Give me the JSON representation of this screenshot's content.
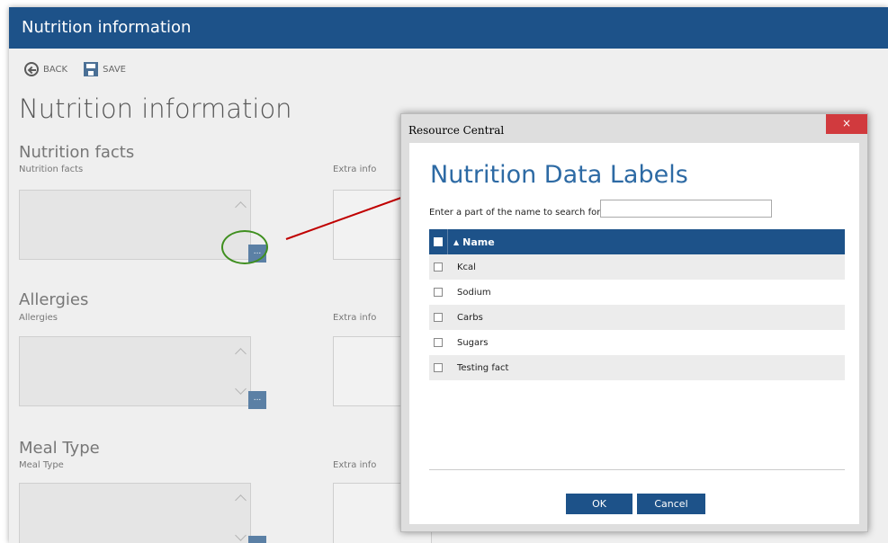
{
  "window": {
    "title": "Nutrition information"
  },
  "toolbar": {
    "back_label": "BACK",
    "save_label": "SAVE"
  },
  "page": {
    "title": "Nutrition information"
  },
  "sections": [
    {
      "title": "Nutrition facts",
      "field_label": "Nutrition facts",
      "extra_label": "Extra info",
      "browse_label": "..."
    },
    {
      "title": "Allergies",
      "field_label": "Allergies",
      "extra_label": "Extra info",
      "browse_label": "..."
    },
    {
      "title": "Meal Type",
      "field_label": "Meal Type",
      "extra_label": "Extra info",
      "browse_label": "..."
    }
  ],
  "dialog": {
    "title": "Resource Central",
    "close_label": "×",
    "heading": "Nutrition Data Labels",
    "search_label": "Enter a part of the name to search for",
    "search_value": "",
    "column_name": "Name",
    "rows": [
      "Kcal",
      "Sodium",
      "Carbs",
      "Sugars",
      "Testing fact"
    ],
    "ok_label": "OK",
    "cancel_label": "Cancel"
  },
  "colors": {
    "brand": "#1d5289",
    "close": "#d13a3e",
    "highlight": "#3f8f1f",
    "arrow": "#c00000"
  },
  "icons": {
    "back": "back-arrow-circle-icon",
    "save": "floppy-disk-icon",
    "sort": "sort-ascending-icon"
  }
}
